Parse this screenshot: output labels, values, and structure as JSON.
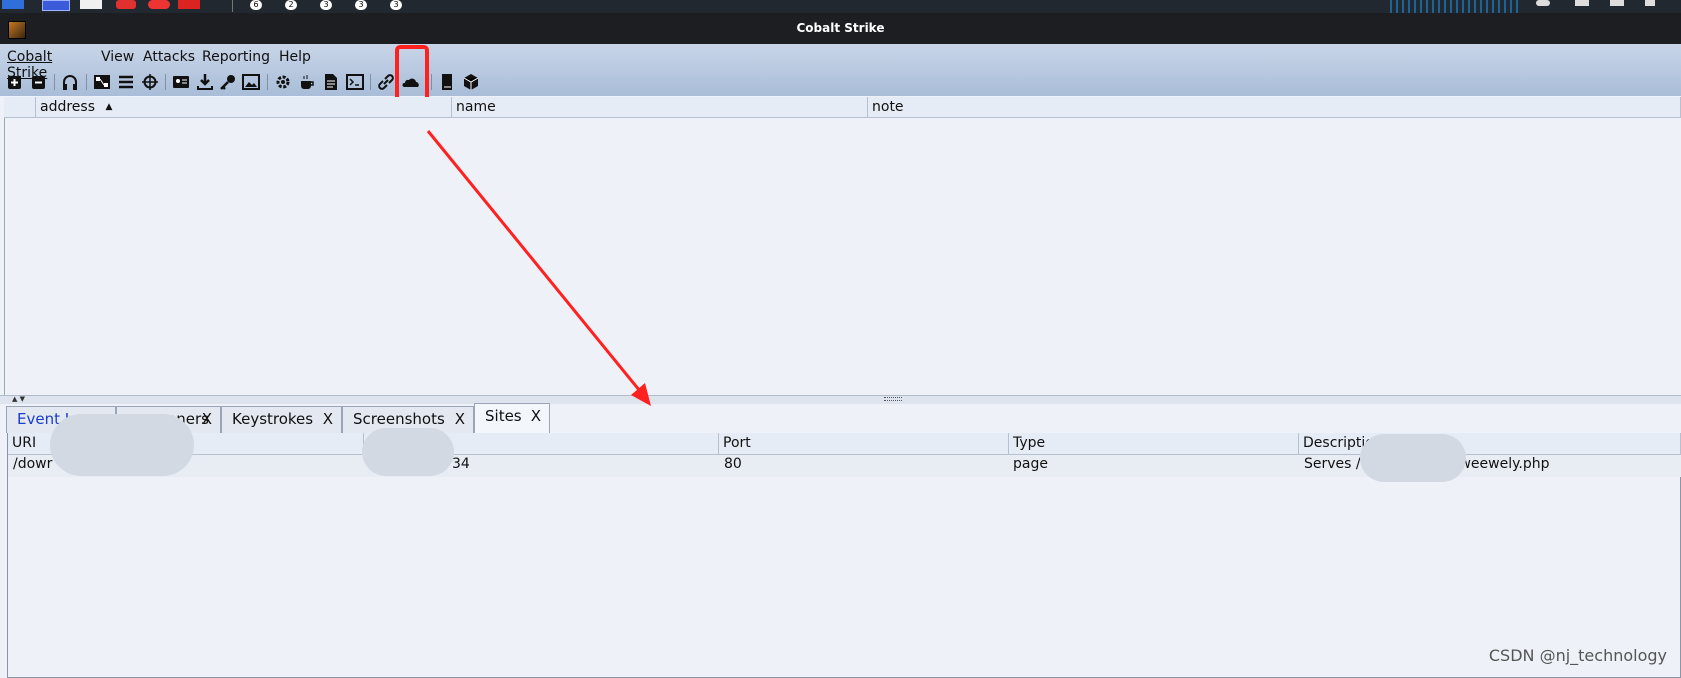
{
  "taskbar": {
    "badges": [
      "6",
      "2",
      "3",
      "3",
      "3"
    ]
  },
  "window": {
    "title": "Cobalt Strike"
  },
  "menu": {
    "items": [
      "Cobalt Strike",
      "View",
      "Attacks",
      "Reporting",
      "Help"
    ]
  },
  "toolbar": {
    "icons": [
      "plus-icon",
      "minus-icon",
      "headphones-icon",
      "graph-view-icon",
      "list-view-icon",
      "target-icon",
      "credentials-icon",
      "download-icon",
      "key-icon",
      "image-icon",
      "settings-icon",
      "coffee-icon",
      "document-icon",
      "console-icon",
      "link-icon",
      "cloud-icon",
      "book-icon",
      "package-icon"
    ],
    "highlighted": "cloud-icon"
  },
  "targets_table": {
    "columns": [
      "address",
      "name",
      "note"
    ],
    "sort_indicator": "▲",
    "rows": []
  },
  "tabs": [
    {
      "label": "Event Lo",
      "close": ""
    },
    {
      "label": "eners",
      "close": "X"
    },
    {
      "label": "Keystrokes",
      "close": "X"
    },
    {
      "label": "Screenshots",
      "close": "X"
    },
    {
      "label": "Sites",
      "close": "X"
    }
  ],
  "sites_table": {
    "columns": [
      "URI",
      "",
      "Port",
      "Type",
      "Description"
    ],
    "rows": [
      {
        "uri": "/dowr",
        "host": "34",
        "port": "80",
        "type": "page",
        "description": "Serves /",
        "description_tail": "ads/weewely.php"
      }
    ]
  },
  "watermark": "CSDN @nj_technology",
  "colors": {
    "highlight": "#ff2020",
    "arrow": "#ff2020",
    "titlebar": "#1d1e22"
  }
}
